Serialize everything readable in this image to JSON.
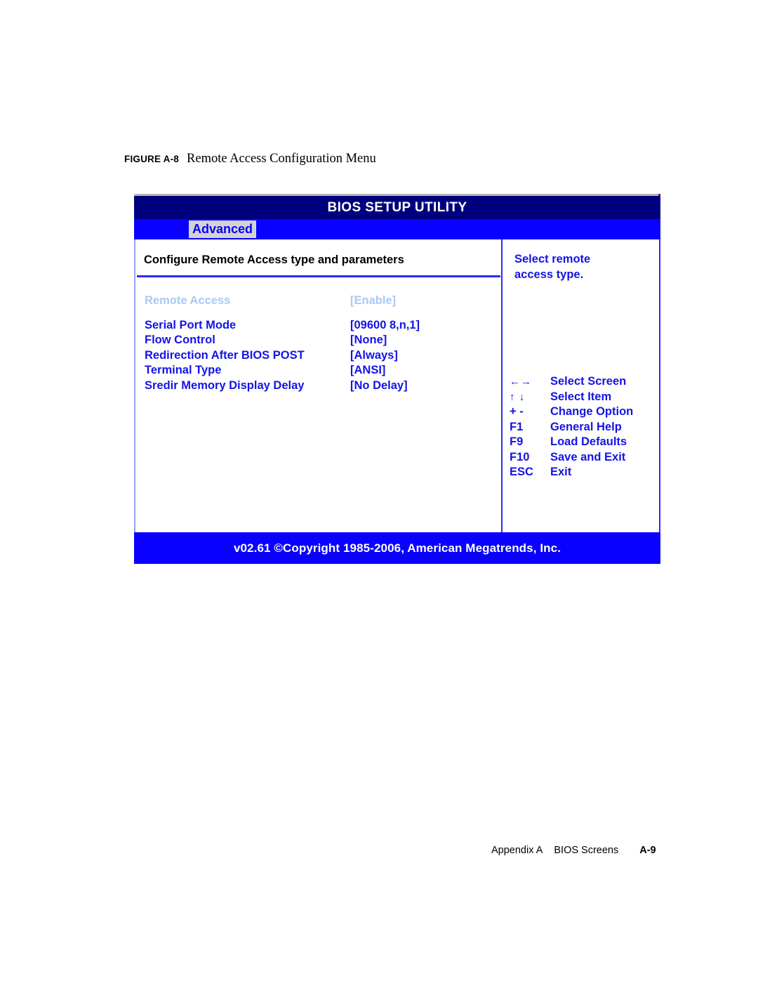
{
  "figure": {
    "label": "FIGURE A-8",
    "text": "Remote Access Configuration Menu"
  },
  "bios": {
    "title": "BIOS SETUP UTILITY",
    "active_tab": "Advanced",
    "main": {
      "heading": "Configure Remote Access type and parameters",
      "settings": [
        {
          "label": "Remote Access",
          "value": "[Enable]",
          "state": "selected"
        },
        {
          "label": "Serial Port Mode",
          "value": "[09600 8,n,1]",
          "state": "normal"
        },
        {
          "label": "Flow Control",
          "value": "[None]",
          "state": "normal"
        },
        {
          "label": "Redirection After BIOS POST",
          "value": "[Always]",
          "state": "normal"
        },
        {
          "label": "Terminal Type",
          "value": "[ANSI]",
          "state": "normal"
        },
        {
          "label": "Sredir Memory Display Delay",
          "value": "[No Delay]",
          "state": "normal"
        }
      ]
    },
    "help": {
      "line1": "Select remote",
      "line2": "access type.",
      "keys": [
        {
          "key": "←→",
          "desc": "Select Screen"
        },
        {
          "key": "↑ ↓",
          "desc": "Select Item"
        },
        {
          "key": "+ -",
          "desc": "Change Option"
        },
        {
          "key": "F1",
          "desc": "General Help"
        },
        {
          "key": "F9",
          "desc": "Load Defaults"
        },
        {
          "key": "F10",
          "desc": "Save and Exit"
        },
        {
          "key": "ESC",
          "desc": "Exit"
        }
      ]
    },
    "footer": "v02.61 ©Copyright 1985-2006, American Megatrends, Inc.",
    "colors": {
      "title_bar": "#00007e",
      "tab_bar": "#0a00ff",
      "accent_blue": "#1414e6",
      "selected_row": "#a9caf5",
      "tab_highlight_bg": "#d3d3d3"
    }
  },
  "page": {
    "appendix": "Appendix A",
    "section": "BIOS Screens",
    "number": "A-9"
  }
}
